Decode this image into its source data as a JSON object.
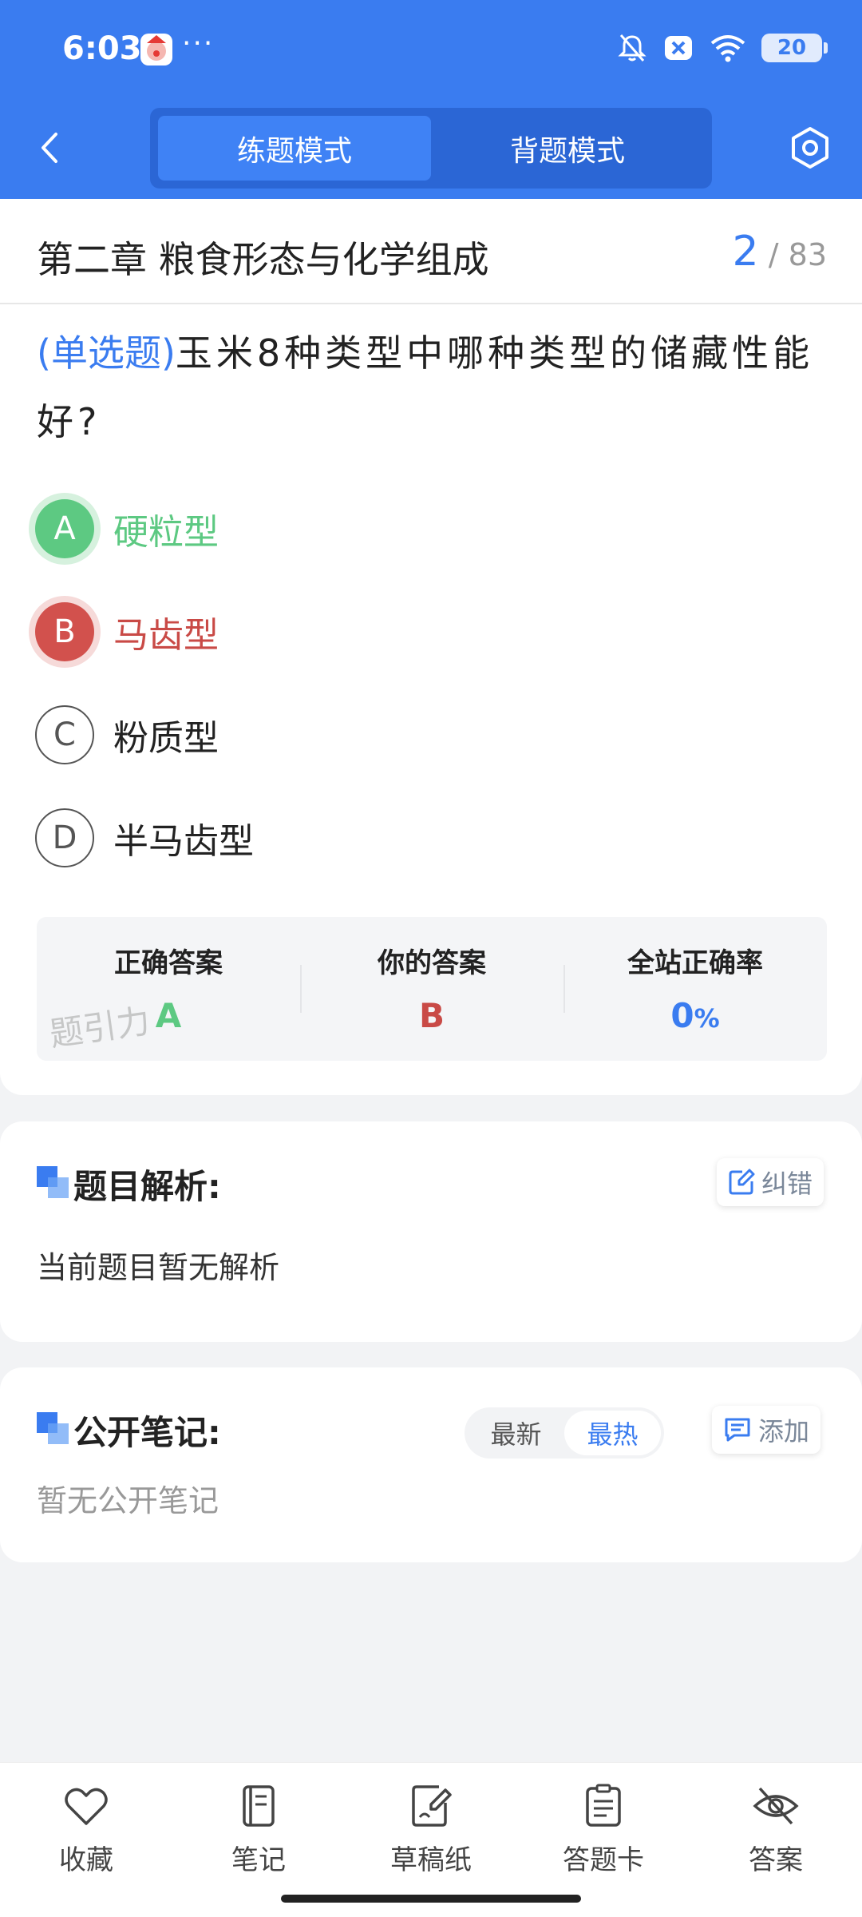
{
  "status_bar": {
    "time": "6:03",
    "dots": "···",
    "battery": "20",
    "icons": [
      "app-icon",
      "mute-icon",
      "close-box-icon",
      "wifi-icon",
      "battery-icon"
    ]
  },
  "header": {
    "modes": [
      "练题模式",
      "背题模式"
    ],
    "active_mode": 0,
    "icons": [
      "back-icon",
      "settings-icon"
    ]
  },
  "question": {
    "chapter": "第二章 粮食形态与化学组成",
    "current": "2",
    "separator": "/",
    "total": "83",
    "type_label": "(单选题)",
    "text": "玉米8种类型中哪种类型的储藏性能好?",
    "options": [
      {
        "letter": "A",
        "text": "硬粒型",
        "state": "correct"
      },
      {
        "letter": "B",
        "text": "马齿型",
        "state": "wrong"
      },
      {
        "letter": "C",
        "text": "粉质型",
        "state": "normal"
      },
      {
        "letter": "D",
        "text": "半马齿型",
        "state": "normal"
      }
    ]
  },
  "stats": {
    "correct_label": "正确答案",
    "correct_value": "A",
    "yours_label": "你的答案",
    "yours_value": "B",
    "rate_label": "全站正确率",
    "rate_value": "0",
    "rate_unit": "%",
    "watermark": "题引力"
  },
  "analysis": {
    "title": "题目解析:",
    "correct_btn": "纠错",
    "body": "当前题目暂无解析"
  },
  "notes": {
    "title": "公开笔记:",
    "sort_options": [
      "最新",
      "最热"
    ],
    "active_sort": 1,
    "add_btn": "添加",
    "body": "暂无公开笔记"
  },
  "bottom_nav": [
    {
      "label": "收藏",
      "icon": "heart-icon"
    },
    {
      "label": "笔记",
      "icon": "notebook-icon"
    },
    {
      "label": "草稿纸",
      "icon": "draft-icon"
    },
    {
      "label": "答题卡",
      "icon": "answer-sheet-icon"
    },
    {
      "label": "答案",
      "icon": "eye-off-icon"
    }
  ],
  "colors": {
    "primary": "#3a7cf0",
    "correct": "#5dc982",
    "wrong": "#d2514d"
  }
}
